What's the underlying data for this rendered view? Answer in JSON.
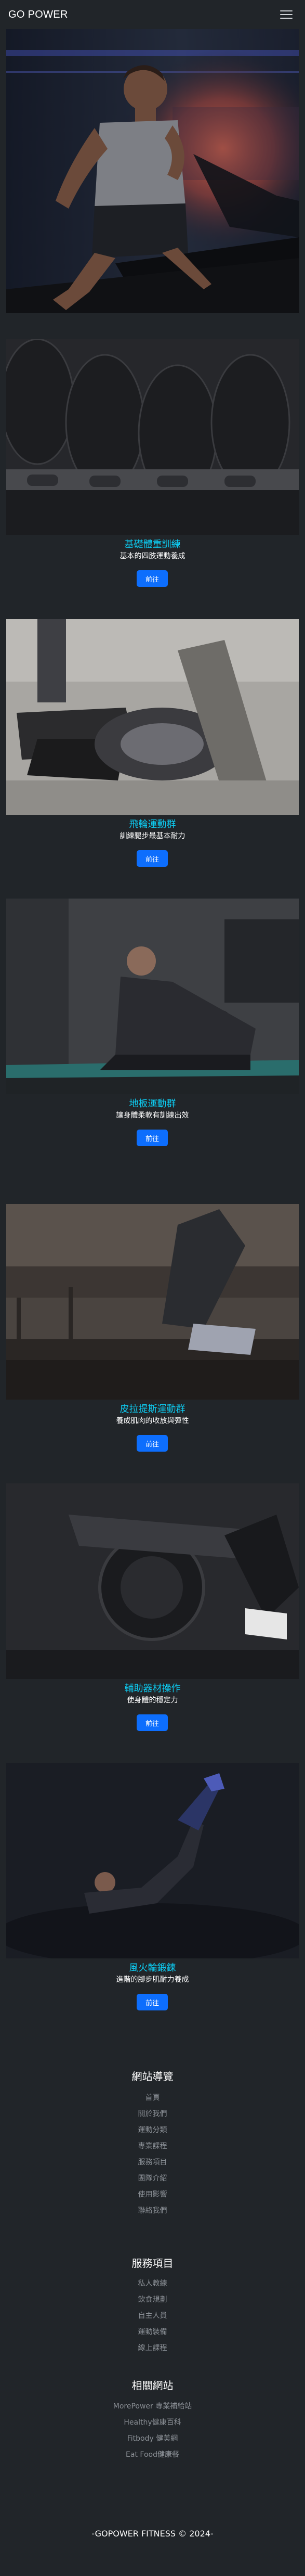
{
  "nav": {
    "brand": "GO POWER"
  },
  "courses": [
    {
      "title": "基礎體重訓練",
      "desc": "基本的四肢運動養成",
      "button": "前往"
    },
    {
      "title": "飛輪運動群",
      "desc": "訓練腿步最基本耐力",
      "button": "前往"
    },
    {
      "title": "地板運動群",
      "desc": "讓身體柔軟有訓練出效",
      "button": "前往"
    },
    {
      "title": "皮拉提斯運動群",
      "desc": "養成肌肉的收放與彈性",
      "button": "前往"
    },
    {
      "title": "輔助器材操作",
      "desc": "使身體的穩定力",
      "button": "前往"
    },
    {
      "title": "風火輪鍛鍊",
      "desc": "進階的腳步肌耐力養成",
      "button": "前往"
    }
  ],
  "footer": {
    "sections": [
      {
        "heading": "網站導覽",
        "links": [
          "首頁",
          "關於我們",
          "運動分類",
          "專業課程",
          "服務項目",
          "團隊介紹",
          "使用影響",
          "聯絡我們"
        ]
      },
      {
        "heading": "服務項目",
        "links": [
          "私人教練",
          "飲食規劃",
          "自主人員",
          "運動裝備",
          "線上課程"
        ]
      },
      {
        "heading": "相關網站",
        "links": [
          "MorePower 專業補給站",
          "Healthy健康百科",
          "Fitbody 健美網",
          "Eat Food健康餐"
        ]
      }
    ],
    "copyright": "-GOPOWER FITNESS © 2024-"
  }
}
